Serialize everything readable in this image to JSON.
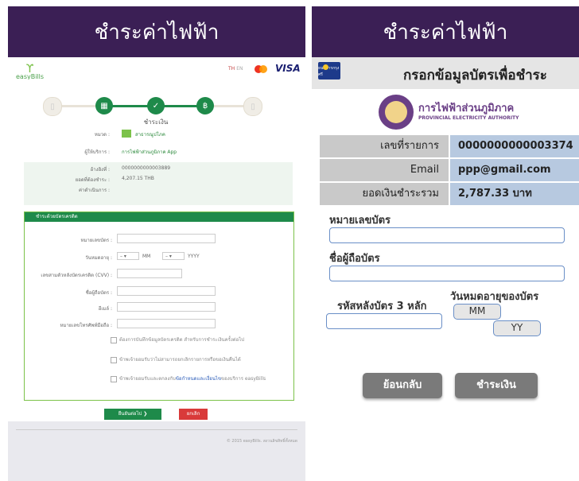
{
  "left": {
    "title": "ชำระค่าไฟฟ้า",
    "header": {
      "logo_text": "easyBills",
      "lang_th": "TH",
      "lang_en": "EN",
      "visa": "VISA"
    },
    "step_label": "ชำระเงิน",
    "info": {
      "category_label": "หมวด :",
      "category_value": "สาธารณูปโภค",
      "provider_label": "ผู้ให้บริการ :",
      "provider_value": "การไฟฟ้าส่วนภูมิภาค App",
      "ref_label": "อ้างอิงที่ :",
      "ref_value": "0000000000003889",
      "amount_label": "ยอดที่ต้องชำระ :",
      "amount_value": "4,207.15  THB",
      "fee_label": "ค่าดำเนินการ :"
    },
    "cc": {
      "header": "ชำระด้วยบัตรเครดิต",
      "card_number_label": "หมายเลขบัตร :",
      "expiry_label": "วันหมดอายุ :",
      "month_value": "MM",
      "year_value": "YYYY",
      "cvv_label": "เลขสามตัวหลังบัตรเครดิต (CVV) :",
      "holder_label": "ชื่อผู้ถือบัตร :",
      "email_label": "อีเมล์ :",
      "phone_label": "หมายเลขโทรศัพท์มือถือ :",
      "check1": "ต้องการบันทึกข้อมูลบัตรเครดิต สำหรับการชำระเงินครั้งต่อไป",
      "check2": "ข้าพเจ้ายอมรับว่าไม่สามารถยกเลิกรายการหรือขอเงินคืนได้",
      "check3_pre": "ข้าพเจ้ายอมรับและตกลงกับ",
      "check3_link": "ข้อกำหนดและเงื่อนไข",
      "check3_post": "ของบริการ easyBills"
    },
    "next_btn": "ยืนยันต่อไป",
    "cancel_btn": "ยกเลิก",
    "footer": "© 2015 easyBills. สงวนลิขสิทธิ์ทั้งหมด"
  },
  "right": {
    "title": "ชำระค่าไฟฟ้า",
    "bank_logo": "ธนาคารกรุงศรี",
    "pay_title": "กรอกข้อมูลบัตรเพื่อชำระ",
    "org_th": "การไฟฟ้าส่วนภูมิภาค",
    "org_en": "PROVINCIAL ELECTRICITY AUTHORITY",
    "rows": [
      {
        "label": "เลขที่รายการ",
        "value": "0000000000003374"
      },
      {
        "label": "Email",
        "value": "ppp@gmail.com"
      },
      {
        "label": "ยอดเงินชำระรวม",
        "value": "2,787.33 บาท"
      }
    ],
    "card_number_label": "หมายเลขบัตร",
    "holder_label": "ชื่อผู้ถือบัตร",
    "cvv_label": "รหัสหลังบัตร 3 หลัก",
    "expiry_label": "วันหมดอายุของบัตร",
    "mm": "MM",
    "yy": "YY",
    "back_btn": "ย้อนกลับ",
    "pay_btn": "ชำระเงิน"
  }
}
